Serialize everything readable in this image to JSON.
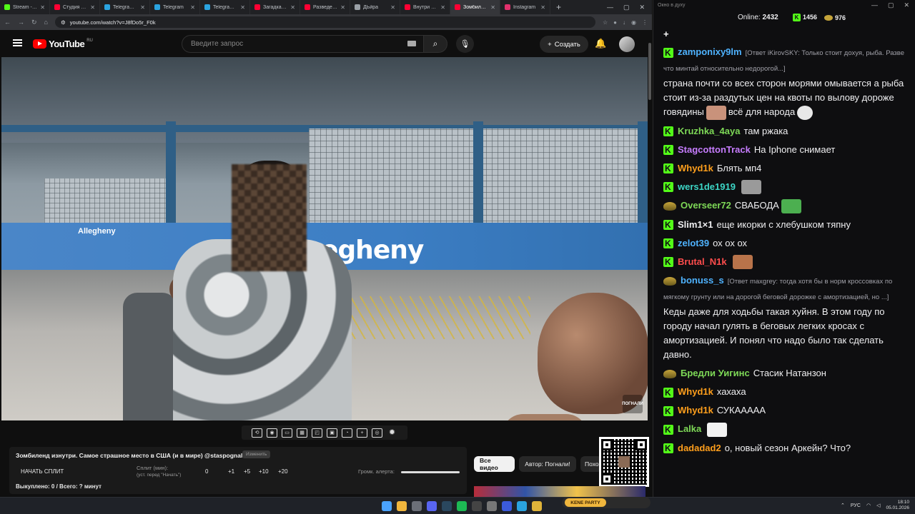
{
  "browser": {
    "tabs": [
      {
        "title": "Stream - Kick",
        "color": "#53fc18",
        "active": false
      },
      {
        "title": "Студия — YouTube",
        "color": "#ff0033",
        "active": false
      },
      {
        "title": "Telegram Web",
        "color": "#2aa3df",
        "active": false
      },
      {
        "title": "Telegram",
        "color": "#2aa3df",
        "active": false
      },
      {
        "title": "Telegram Web",
        "color": "#2aa3df",
        "active": false
      },
      {
        "title": "Загадка аре...",
        "color": "#ff0033",
        "active": false
      },
      {
        "title": "Разведенка",
        "color": "#ff0033",
        "active": false
      },
      {
        "title": "ДЬйра",
        "color": "#9aa0a6",
        "active": false
      },
      {
        "title": "Внутри сом...",
        "color": "#ff0033",
        "active": false
      },
      {
        "title": "Зомбиленд",
        "color": "#ff0033",
        "active": true
      },
      {
        "title": "Instagram",
        "color": "#e1306c",
        "active": false
      }
    ],
    "url": "youtube.com/watch?v=J8fDo5r_F0k"
  },
  "youtube": {
    "logo": "YouTube",
    "region": "RU",
    "search_placeholder": "Введите запрос",
    "create_label": "Создать"
  },
  "video": {
    "sign_main": "egheny",
    "sign_small": "Allegheny",
    "watermark": "ПОГНАЛИ"
  },
  "player_tools": [
    "loop-icon",
    "broadcast-icon",
    "screen-icon",
    "film-icon",
    "pip-icon",
    "clip-icon",
    "speed-icon",
    "add-icon",
    "camera-icon",
    "settings-icon"
  ],
  "extension": {
    "title": "Зомбиленд изнутри. Самое страшное место в США (и в мире) @staspognali",
    "tag": "Изменить",
    "split_button": "НАЧАТЬ СПЛИТ",
    "split_label_1": "Сплит (мин):",
    "split_label_2": "(уст. перед \"Начать\")",
    "split_values": [
      "0",
      "+1",
      "+5",
      "+10",
      "+20"
    ],
    "alert_label": "Громк. алерта:",
    "bought": "Выкуплено: 0 / Всего: ? минут"
  },
  "chips": {
    "all": "Все видео",
    "author": "Автор: Погнали!",
    "similar": "Похо"
  },
  "chat": {
    "window_title": "Окно в духу",
    "online_label": "Online:",
    "online_count": "2432",
    "k_count": "1456",
    "coin_count": "976",
    "messages": [
      {
        "badge": "k",
        "user": "zamponixy9lm",
        "color": "#4fb3ff",
        "reply": "[Ответ iKirovSKY: Только стоит дохуя, рыба. Разве что минтай относительно недорогой...]",
        "text": "страна почти со всех сторон морями омывается а рыба стоит из-за раздутых цен на квоты по вылову дороже говядины",
        "emote": "#c9927b",
        "tail": "всё для народа",
        "emote2": "#e8e8e8"
      },
      {
        "badge": "k",
        "user": "Kruzhka_4aya",
        "color": "#7ed957",
        "text": "там ржака"
      },
      {
        "badge": "k",
        "user": "StagcottonTrack",
        "color": "#c77dff",
        "text": "На Iphone снимает"
      },
      {
        "badge": "k",
        "user": "Whyd1k",
        "color": "#ff9f1c",
        "text": "Блять мп4"
      },
      {
        "badge": "k",
        "user": "wers1de1919",
        "color": "#3dd6c6",
        "text": "",
        "emote": "#9a9a9a"
      },
      {
        "badge": "g",
        "user": "Overseer72",
        "color": "#7ed957",
        "text": "СВАБОДА",
        "emote": "#4caf50"
      },
      {
        "badge": "k",
        "user": "Slim1×1",
        "color": "#efeff1",
        "text": "еще икорки с хлебушком тяпну"
      },
      {
        "badge": "k",
        "user": "zelot39",
        "color": "#4fb3ff",
        "text": "ох ох ох"
      },
      {
        "badge": "k",
        "user": "Brutal_N1k",
        "color": "#ff4d4d",
        "text": "",
        "emote": "#b8734a"
      },
      {
        "badge": "g",
        "user": "bonuss_s",
        "color": "#4fb3ff",
        "reply": "[Ответ maxgrey: тогда хотя бы в норм кроссовках по мягкому грунту или на дорогой беговой дорожке с амортизацией, но ...]",
        "text": "Кеды даже для ходьбы такая хуйня. В этом году по городу начал гулять в беговых легких кросах с амортизацией. И  понял что надо было так сделать давно."
      },
      {
        "badge": "g",
        "user": "Бредли Уигинс",
        "color": "#7ed957",
        "text": "Стасик Натанзон"
      },
      {
        "badge": "k",
        "user": "Whyd1k",
        "color": "#ff9f1c",
        "text": "хахаха"
      },
      {
        "badge": "k",
        "user": "Whyd1k",
        "color": "#ff9f1c",
        "text": "СУКАААAA"
      },
      {
        "badge": "k",
        "user": "Lalka",
        "color": "#7ed957",
        "text": "",
        "emote": "#f2f2f2"
      },
      {
        "badge": "k",
        "user": "dadadad2",
        "color": "#ff9f1c",
        "text": "о, новый сезон Аркейн? Что?"
      }
    ]
  },
  "taskbar": {
    "lang": "РУС",
    "time": "18:10",
    "date": "05.01.2026",
    "overlay_label": "KENE PARTY"
  }
}
